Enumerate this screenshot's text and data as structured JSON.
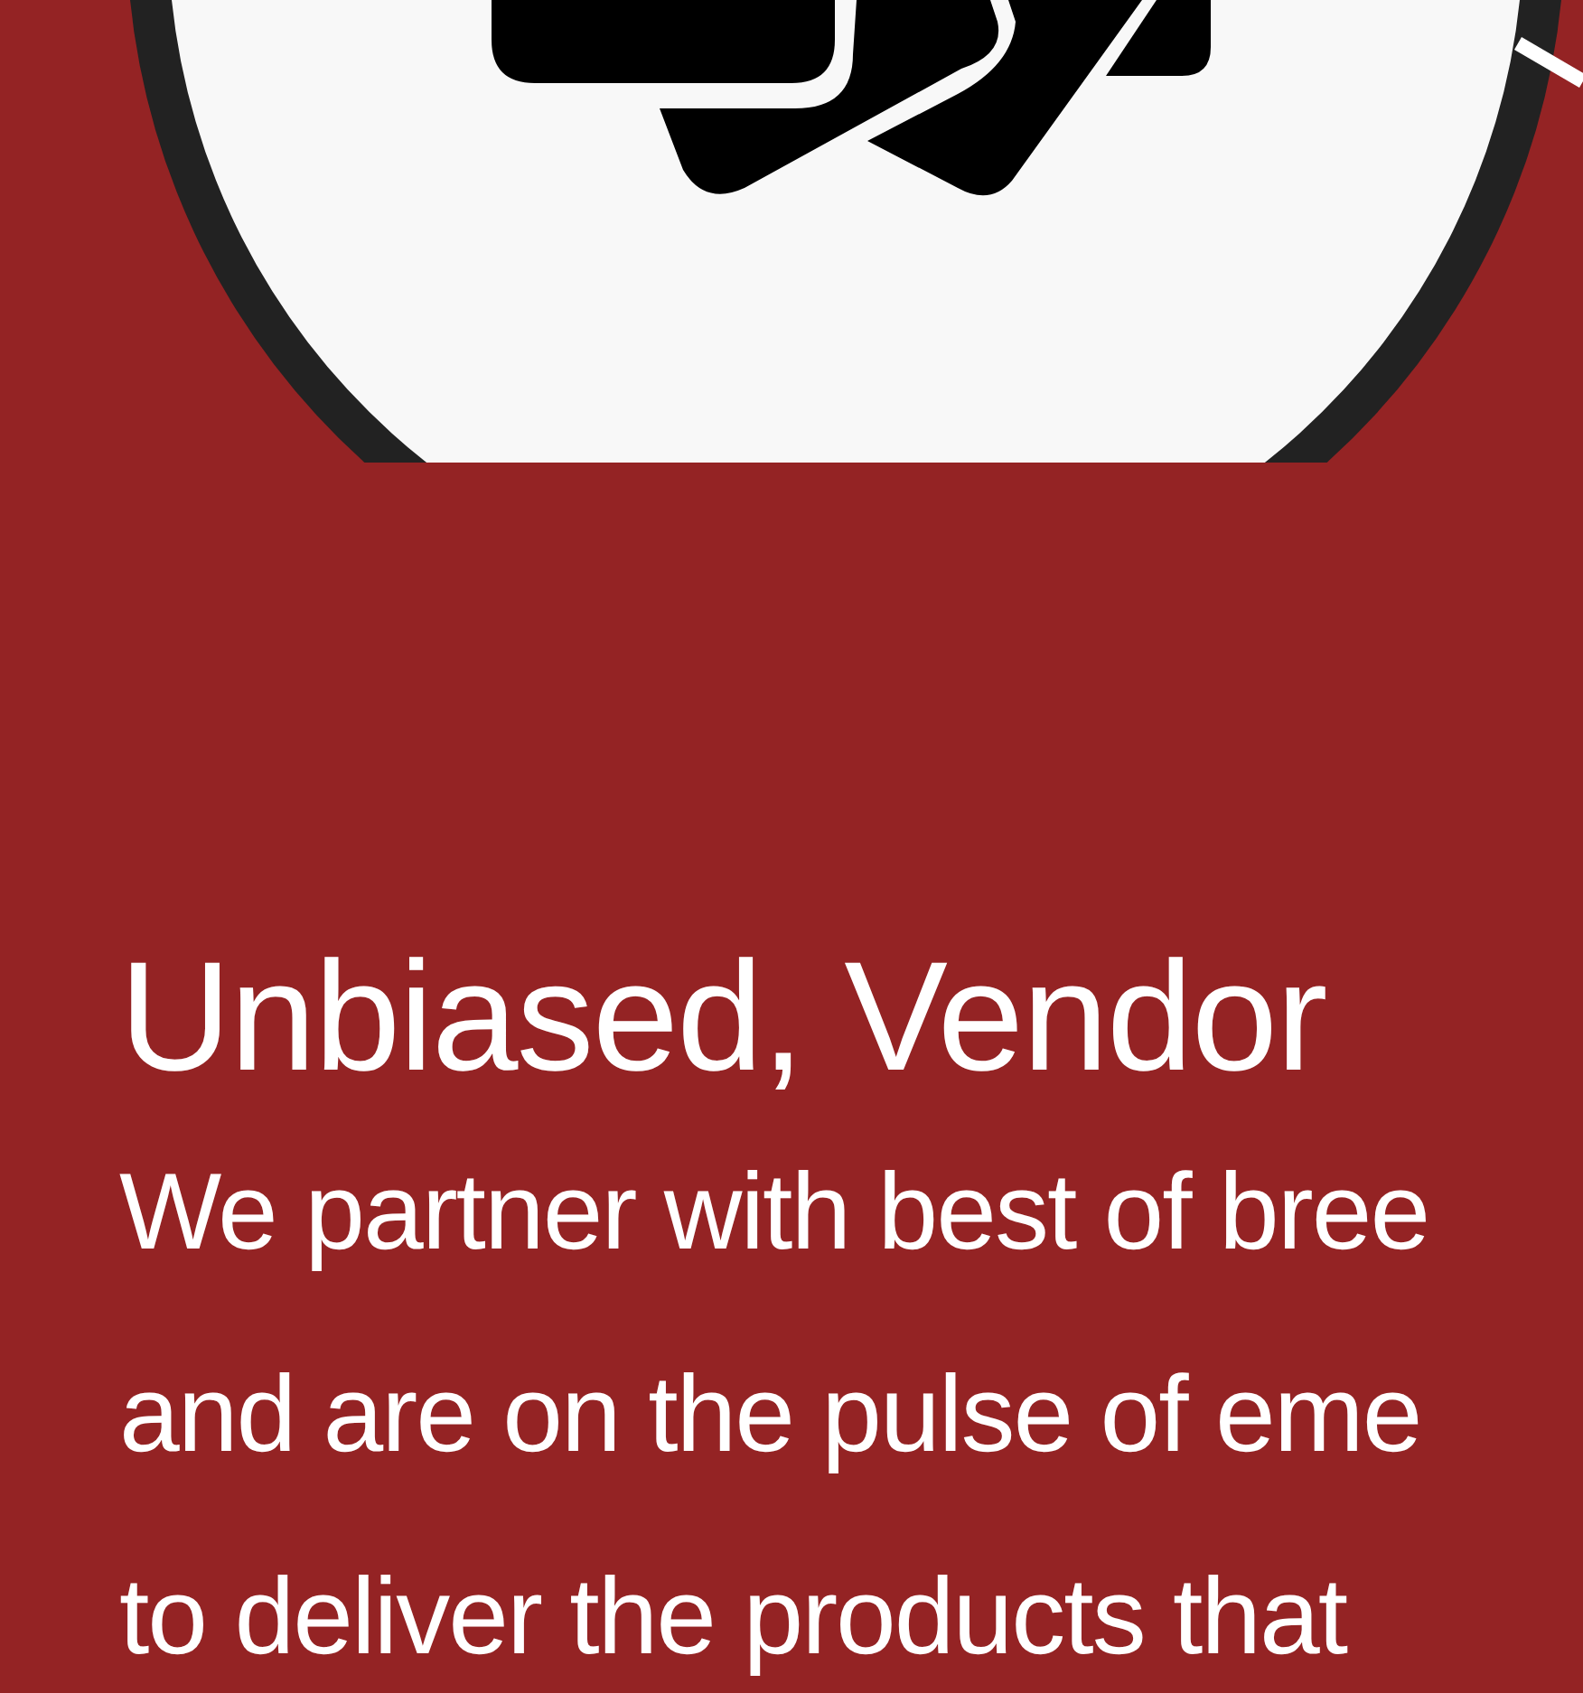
{
  "section": {
    "heading": "Unbiased, Vendor",
    "lines": [
      "We partner with best of bree",
      "and are on the pulse of eme",
      "to deliver the products that"
    ]
  }
}
